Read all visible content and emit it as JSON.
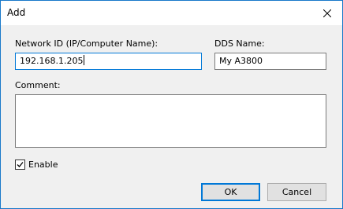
{
  "window": {
    "title": "Add",
    "close_icon": "close-icon"
  },
  "form": {
    "network_id_label": "Network ID (IP/Computer Name):",
    "network_id_value": "192.168.1.205",
    "dds_name_label": "DDS Name:",
    "dds_name_value": "My A3800",
    "comment_label": "Comment:",
    "comment_value": "",
    "enable_label": "Enable",
    "enable_checked": true
  },
  "buttons": {
    "ok_label": "OK",
    "cancel_label": "Cancel"
  },
  "colors": {
    "dialog_background": "#f0f0f0",
    "focus_accent": "#0078d7"
  }
}
